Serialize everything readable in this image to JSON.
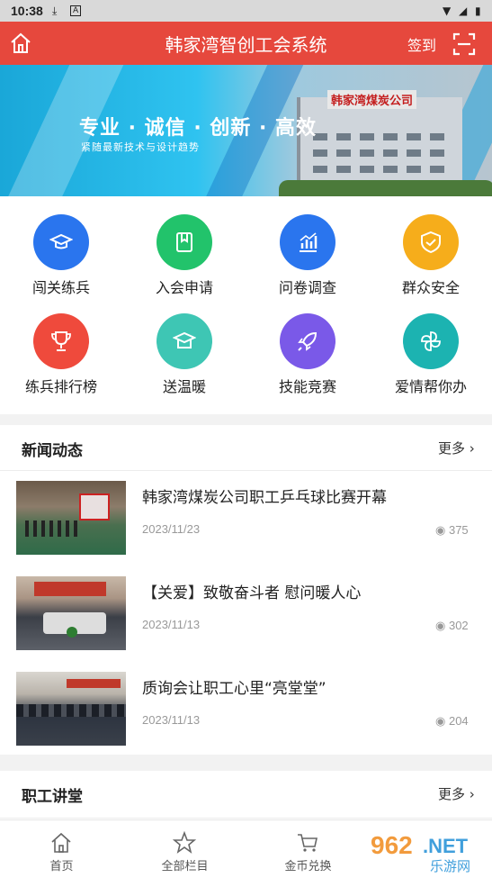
{
  "status": {
    "time": "10:38"
  },
  "header": {
    "title": "韩家湾智创工会系统",
    "signin": "签到"
  },
  "banner": {
    "slogan": "专业 · 诚信 · 创新 · 高效",
    "subline": "紧随最新技术与设计趋势",
    "sign": "韩家湾煤炭公司"
  },
  "features": [
    {
      "label": "闯关练兵",
      "color": "#2a75ee",
      "icon": "graduation-cap-icon"
    },
    {
      "label": "入会申请",
      "color": "#22c36b",
      "icon": "bookmark-form-icon"
    },
    {
      "label": "问卷调查",
      "color": "#2a75ee",
      "icon": "bar-chart-icon"
    },
    {
      "label": "群众安全",
      "color": "#f6ad1b",
      "icon": "shield-check-icon"
    },
    {
      "label": "练兵排行榜",
      "color": "#ef4a3c",
      "icon": "trophy-icon"
    },
    {
      "label": "送温暖",
      "color": "#3ec6b4",
      "icon": "mortarboard-icon"
    },
    {
      "label": "技能竞赛",
      "color": "#7a59e8",
      "icon": "rocket-icon"
    },
    {
      "label": "爱情帮你办",
      "color": "#1cb3b1",
      "icon": "pinwheel-icon"
    }
  ],
  "news": {
    "title": "新闻动态",
    "more": "更多",
    "items": [
      {
        "title": "韩家湾煤炭公司职工乒乓球比赛开幕",
        "date": "2023/11/23",
        "views": "375"
      },
      {
        "title": "【关爱】致敬奋斗者 慰问暖人心",
        "date": "2023/11/13",
        "views": "302"
      },
      {
        "title": "质询会让职工心里“亮堂堂”",
        "date": "2023/11/13",
        "views": "204"
      }
    ]
  },
  "lecture": {
    "title": "职工讲堂",
    "more": "更多"
  },
  "tabs": [
    {
      "label": "首页",
      "icon": "home-icon"
    },
    {
      "label": "全部栏目",
      "icon": "star-icon"
    },
    {
      "label": "金币兑换",
      "icon": "cart-icon"
    }
  ],
  "watermark": "962.NET 乐游网"
}
